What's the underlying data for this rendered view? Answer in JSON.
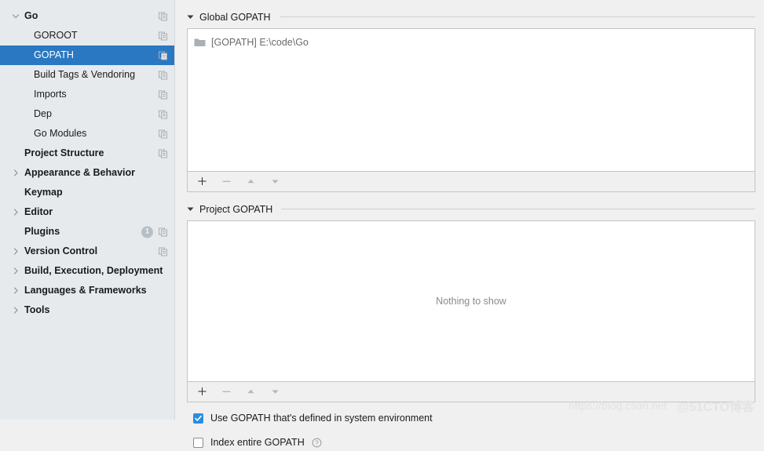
{
  "sidebar": {
    "items": [
      {
        "label": "Go",
        "bold": true,
        "indent": "root",
        "chevron": "chevron-down",
        "copy_icon": true,
        "selected": false
      },
      {
        "label": "GOROOT",
        "bold": false,
        "indent": "child",
        "chevron": "",
        "copy_icon": true,
        "selected": false
      },
      {
        "label": "GOPATH",
        "bold": false,
        "indent": "child",
        "chevron": "",
        "copy_icon": true,
        "selected": true
      },
      {
        "label": "Build Tags & Vendoring",
        "bold": false,
        "indent": "child",
        "chevron": "",
        "copy_icon": true,
        "selected": false
      },
      {
        "label": "Imports",
        "bold": false,
        "indent": "child",
        "chevron": "",
        "copy_icon": true,
        "selected": false
      },
      {
        "label": "Dep",
        "bold": false,
        "indent": "child",
        "chevron": "",
        "copy_icon": true,
        "selected": false
      },
      {
        "label": "Go Modules",
        "bold": false,
        "indent": "child",
        "chevron": "",
        "copy_icon": true,
        "selected": false
      },
      {
        "label": "Project Structure",
        "bold": true,
        "indent": "top",
        "chevron": "",
        "copy_icon": true,
        "selected": false
      },
      {
        "label": "Appearance & Behavior",
        "bold": true,
        "indent": "top",
        "chevron": "chevron-right",
        "copy_icon": false,
        "selected": false
      },
      {
        "label": "Keymap",
        "bold": true,
        "indent": "top",
        "chevron": "",
        "copy_icon": false,
        "selected": false
      },
      {
        "label": "Editor",
        "bold": true,
        "indent": "top",
        "chevron": "chevron-right",
        "copy_icon": false,
        "selected": false
      },
      {
        "label": "Plugins",
        "bold": true,
        "indent": "top",
        "chevron": "",
        "copy_icon": true,
        "badge": "1",
        "selected": false
      },
      {
        "label": "Version Control",
        "bold": true,
        "indent": "top",
        "chevron": "chevron-right",
        "copy_icon": true,
        "selected": false
      },
      {
        "label": "Build, Execution, Deployment",
        "bold": true,
        "indent": "top",
        "chevron": "chevron-right",
        "copy_icon": false,
        "selected": false
      },
      {
        "label": "Languages & Frameworks",
        "bold": true,
        "indent": "top",
        "chevron": "chevron-right",
        "copy_icon": false,
        "selected": false
      },
      {
        "label": "Tools",
        "bold": true,
        "indent": "top",
        "chevron": "chevron-right",
        "copy_icon": false,
        "selected": false
      }
    ]
  },
  "main": {
    "global_section": {
      "title": "Global GOPATH",
      "collapsed": false,
      "entries": [
        {
          "icon": "folder-icon",
          "text": "[GOPATH] E:\\code\\Go"
        }
      ],
      "toolbar": {
        "add_label": "+",
        "remove_label": "−",
        "up_label": "▲",
        "down_label": "▼"
      }
    },
    "project_section": {
      "title": "Project GOPATH",
      "collapsed": false,
      "empty_text": "Nothing to show",
      "toolbar": {
        "add_label": "+",
        "remove_label": "−",
        "up_label": "▲",
        "down_label": "▼"
      }
    },
    "options": [
      {
        "label": "Use GOPATH that's defined in system environment",
        "checked": true,
        "help": false
      },
      {
        "label": "Index entire GOPATH",
        "checked": false,
        "help": true
      }
    ]
  },
  "watermarks": {
    "csdn": "https://blog.csdn.net",
    "cto": "@51CTO博客"
  },
  "colors": {
    "selection_blue": "#2a78c2",
    "checkbox_blue": "#2a8ce0",
    "sidebar_bg": "#e6eaed",
    "panel_bg": "#f0f0f0",
    "list_bg": "#ffffff"
  }
}
